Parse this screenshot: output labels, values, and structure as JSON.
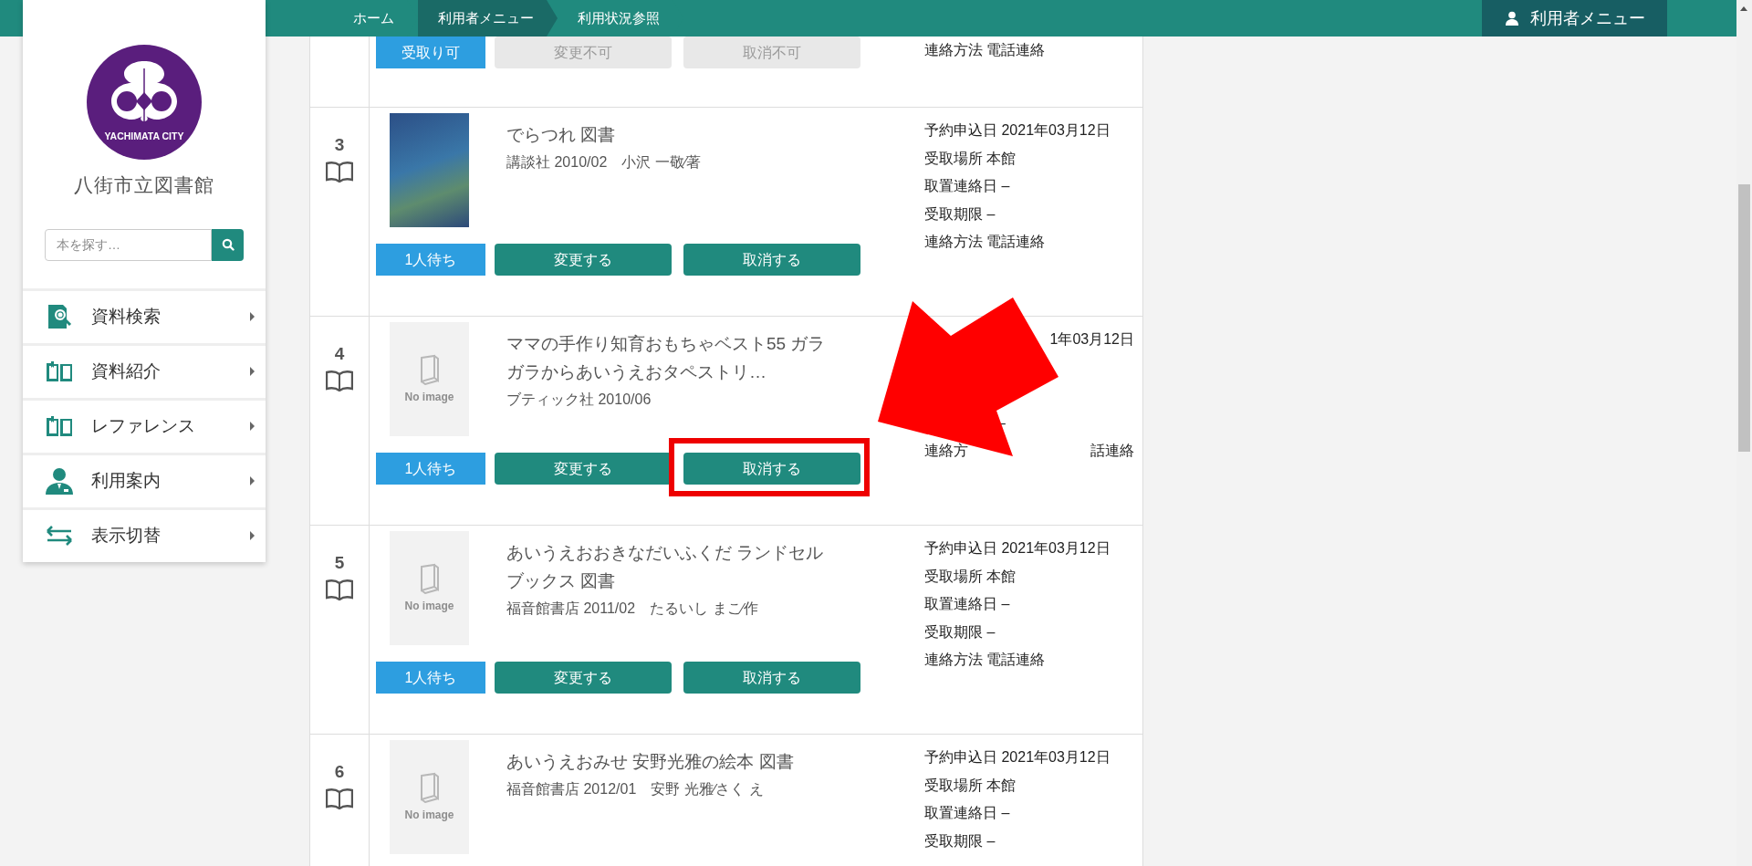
{
  "header": {
    "breadcrumbs": [
      {
        "label": "ホーム",
        "highlighted": false
      },
      {
        "label": "利用者メニュー",
        "highlighted": true
      },
      {
        "label": "利用状況参照",
        "highlighted": false
      }
    ],
    "user_menu": {
      "label": "利用者メニュー"
    }
  },
  "sidebar": {
    "logo": {
      "text": "YACHIMATA CITY"
    },
    "library_name": "八街市立図書館",
    "search": {
      "placeholder": "本を探す…"
    },
    "items": [
      {
        "label": "資料検索",
        "kind": "search"
      },
      {
        "label": "資料紹介",
        "kind": "book"
      },
      {
        "label": "レファレンス",
        "kind": "book"
      },
      {
        "label": "利用案内",
        "kind": "person"
      },
      {
        "label": "表示切替",
        "kind": "swap"
      }
    ]
  },
  "reservations": [
    {
      "kind": "partial",
      "status": "受取り可",
      "buttons": [
        {
          "label": "変更不可",
          "disabled": true
        },
        {
          "label": "取消不可",
          "disabled": true
        }
      ],
      "info": [
        {
          "kind": "text",
          "text": "連絡方法 電話連絡"
        }
      ]
    },
    {
      "kind": "full",
      "number": "3",
      "cover": {
        "kind": "photo"
      },
      "title": "でらつれ 図書",
      "meta": "講談社 2010/02　小沢 一敬∕著",
      "status": "1人待ち",
      "buttons": [
        {
          "label": "変更する",
          "disabled": false
        },
        {
          "label": "取消する",
          "disabled": false
        }
      ],
      "info": [
        {
          "kind": "text",
          "text": "予約申込日 2021年03月12日"
        },
        {
          "kind": "text",
          "text": "受取場所 本館"
        },
        {
          "kind": "text",
          "text": "取置連絡日 –"
        },
        {
          "kind": "text",
          "text": "受取期限 –"
        },
        {
          "kind": "text",
          "text": "連絡方法 電話連絡"
        }
      ]
    },
    {
      "kind": "full",
      "number": "4",
      "cover": {
        "kind": "none",
        "label": "No image"
      },
      "title": "ママの手作り知育おもちゃベスト55 ガラガラからあいうえおタペストリ…",
      "meta": "ブティック社 2010/06",
      "status": "1人待ち",
      "buttons": [
        {
          "label": "変更する",
          "disabled": false
        },
        {
          "label": "取消する",
          "disabled": false
        }
      ],
      "info": [
        {
          "kind": "tail",
          "text": "1年03月12日"
        },
        {
          "kind": "blank"
        },
        {
          "kind": "blank"
        },
        {
          "kind": "indent",
          "text": "–"
        },
        {
          "kind": "split",
          "start": "連絡方",
          "end": "話連絡"
        }
      ]
    },
    {
      "kind": "full",
      "number": "5",
      "cover": {
        "kind": "none",
        "label": "No image"
      },
      "title": "あいうえおおきなだいふくだ ランドセルブックス 図書",
      "meta": "福音館書店 2011/02　たるいし まこ∕作",
      "status": "1人待ち",
      "buttons": [
        {
          "label": "変更する",
          "disabled": false
        },
        {
          "label": "取消する",
          "disabled": false
        }
      ],
      "info": [
        {
          "kind": "text",
          "text": "予約申込日 2021年03月12日"
        },
        {
          "kind": "text",
          "text": "受取場所 本館"
        },
        {
          "kind": "text",
          "text": "取置連絡日 –"
        },
        {
          "kind": "text",
          "text": "受取期限 –"
        },
        {
          "kind": "text",
          "text": "連絡方法 電話連絡"
        }
      ]
    },
    {
      "kind": "full",
      "number": "6",
      "cover": {
        "kind": "none",
        "label": "No image"
      },
      "title": "あいうえおみせ 安野光雅の絵本 図書",
      "meta": "福音館書店 2012/01　安野 光雅∕さく え",
      "info": [
        {
          "kind": "text",
          "text": "予約申込日 2021年03月12日"
        },
        {
          "kind": "text",
          "text": "受取場所 本館"
        },
        {
          "kind": "text",
          "text": "取置連絡日 –"
        },
        {
          "kind": "text",
          "text": "受取期限 –"
        }
      ]
    }
  ],
  "overlay": {
    "arrow": true,
    "frame": true
  }
}
